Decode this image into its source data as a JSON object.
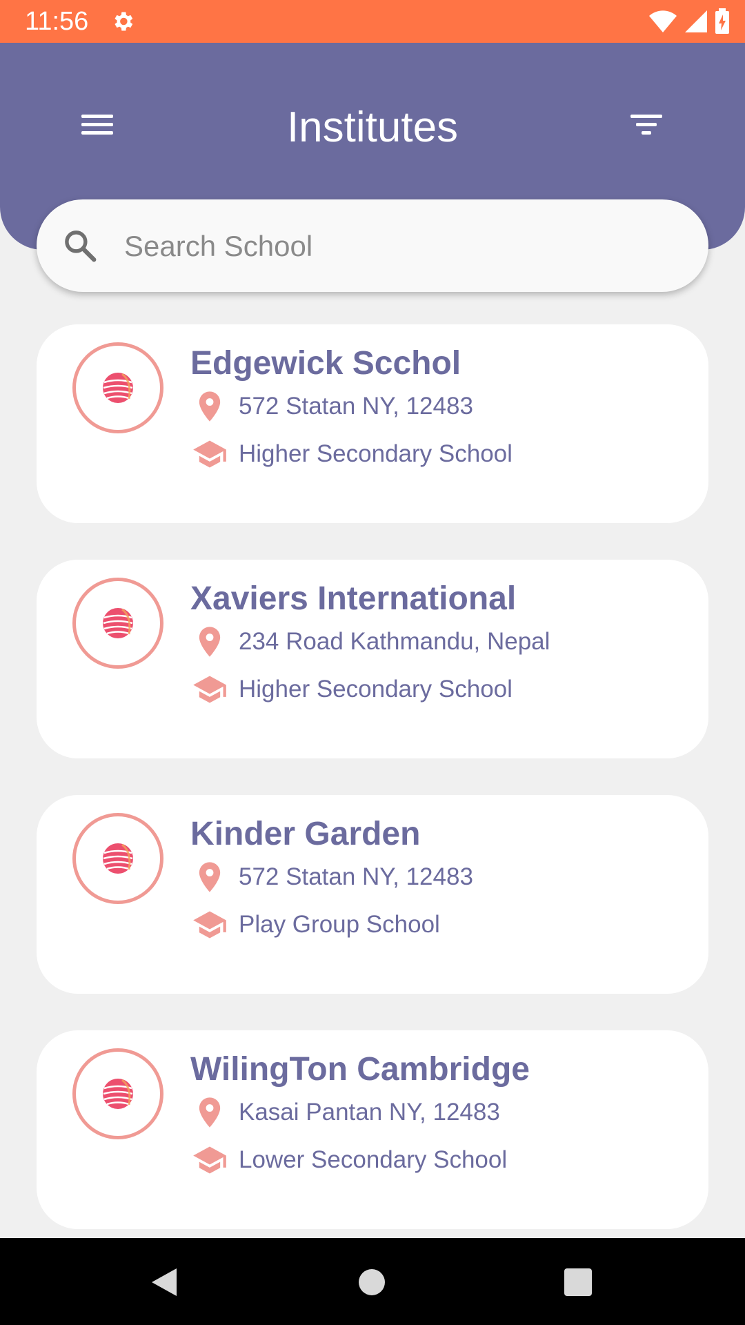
{
  "status_bar": {
    "time": "11:56",
    "settings_icon": "gear-icon",
    "wifi_icon": "wifi-icon",
    "signal_icon": "signal-icon",
    "battery_icon": "battery-charging-icon"
  },
  "app_bar": {
    "title": "Institutes",
    "menu_icon": "hamburger-menu-icon",
    "filter_icon": "filter-icon"
  },
  "search": {
    "placeholder": "Search School",
    "value": "",
    "icon": "search-icon"
  },
  "schools": [
    {
      "name": "Edgewick Scchol",
      "address": "572 Statan NY, 12483",
      "type": "Higher Secondary School"
    },
    {
      "name": "Xaviers International",
      "address": "234 Road Kathmandu, Nepal",
      "type": "Higher Secondary School"
    },
    {
      "name": "Kinder Garden",
      "address": "572 Statan NY, 12483",
      "type": "Play Group School"
    },
    {
      "name": "WilingTon Cambridge",
      "address": "Kasai Pantan NY, 12483",
      "type": "Lower Secondary School"
    }
  ],
  "colors": {
    "status_bar": "#ff7445",
    "primary": "#6b6b9e",
    "accent": "#f09a94",
    "background": "#f0f0f0"
  },
  "nav_bar": {
    "back_icon": "back-triangle-icon",
    "home_icon": "home-circle-icon",
    "recents_icon": "recents-square-icon"
  }
}
